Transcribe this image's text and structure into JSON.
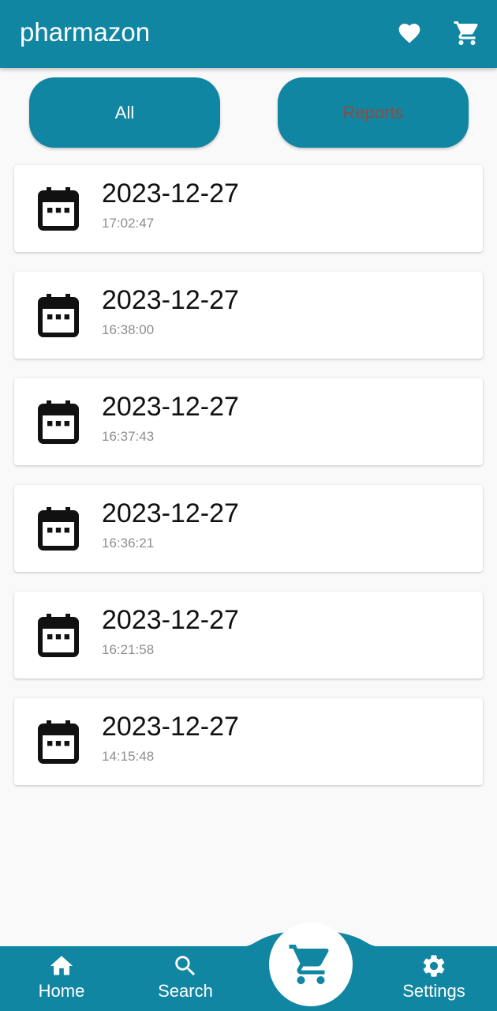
{
  "app": {
    "title": "pharmazon",
    "theme_color": "#1186a2",
    "actions": [
      {
        "icon": "heart-icon"
      },
      {
        "icon": "cart-icon"
      }
    ]
  },
  "filters": {
    "all_label": "All",
    "reports_label": "Reports",
    "selected": "All"
  },
  "records": [
    {
      "date": "2023-12-27",
      "time": "17:02:47",
      "icon": "calendar-icon"
    },
    {
      "date": "2023-12-27",
      "time": "16:38:00",
      "icon": "calendar-icon"
    },
    {
      "date": "2023-12-27",
      "time": "16:37:43",
      "icon": "calendar-icon"
    },
    {
      "date": "2023-12-27",
      "time": "16:36:21",
      "icon": "calendar-icon"
    },
    {
      "date": "2023-12-27",
      "time": "16:21:58",
      "icon": "calendar-icon"
    },
    {
      "date": "2023-12-27",
      "time": "14:15:48",
      "icon": "calendar-icon"
    }
  ],
  "bottom_nav": {
    "home_label": "Home",
    "search_label": "Search",
    "settings_label": "Settings",
    "center_icon": "cart-icon"
  }
}
